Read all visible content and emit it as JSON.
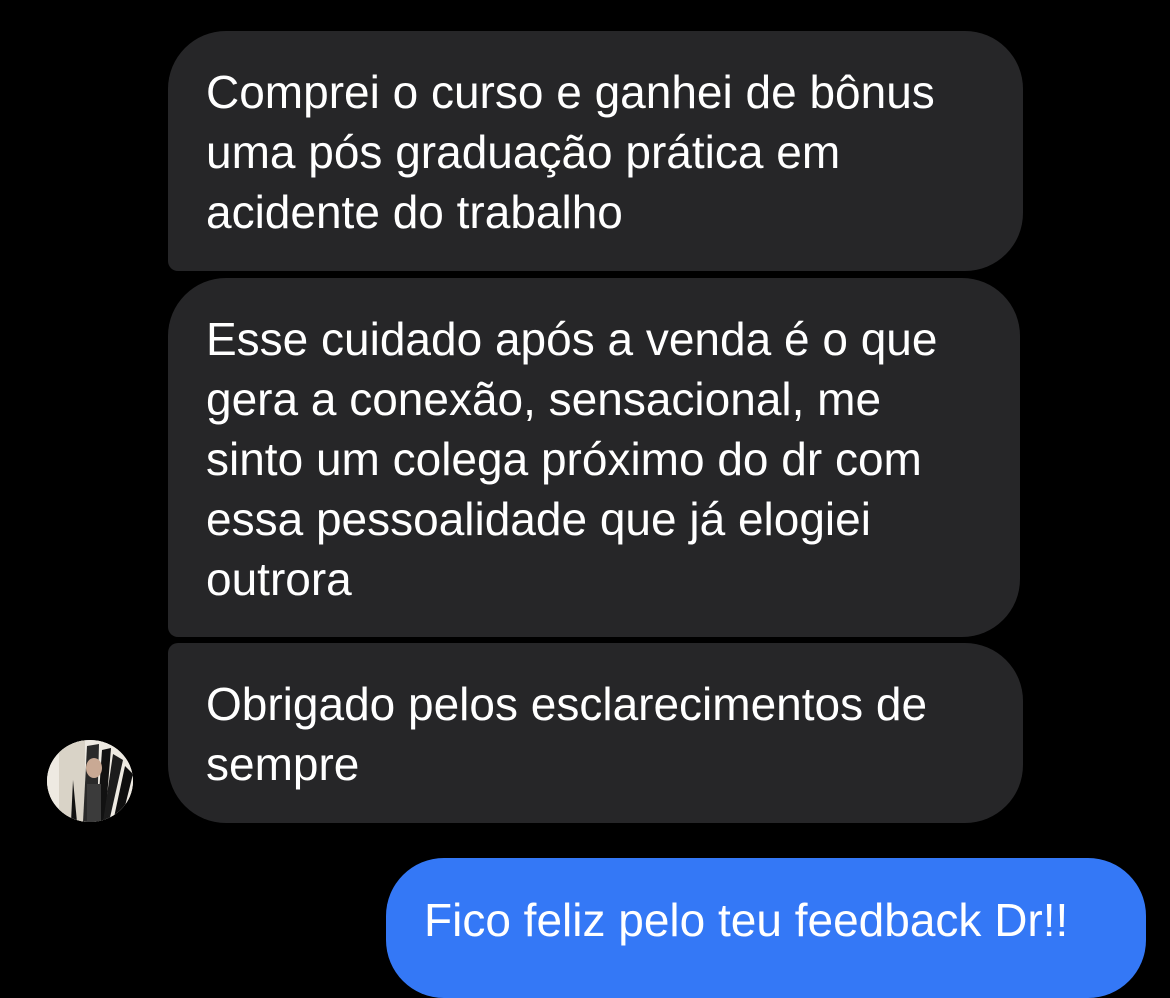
{
  "conversation": {
    "incoming_messages": [
      {
        "text": "Comprei o curso e ganhei de bônus uma pós graduação prática em acidente do trabalho"
      },
      {
        "text": "Esse cuidado após a venda é o que gera a conexão, sensacional, me sinto um colega próximo do dr com essa pessoalidade que já elogiei outrora"
      },
      {
        "text": "Obrigado pelos esclarecimentos de sempre"
      }
    ],
    "outgoing_messages": [
      {
        "text": "Fico feliz pelo teu feedback Dr!!"
      }
    ],
    "sender_avatar_icon": "user-avatar-icon"
  },
  "colors": {
    "background": "#000000",
    "incoming_bubble": "#262628",
    "outgoing_bubble": "#3478f6",
    "text": "#ffffff"
  }
}
